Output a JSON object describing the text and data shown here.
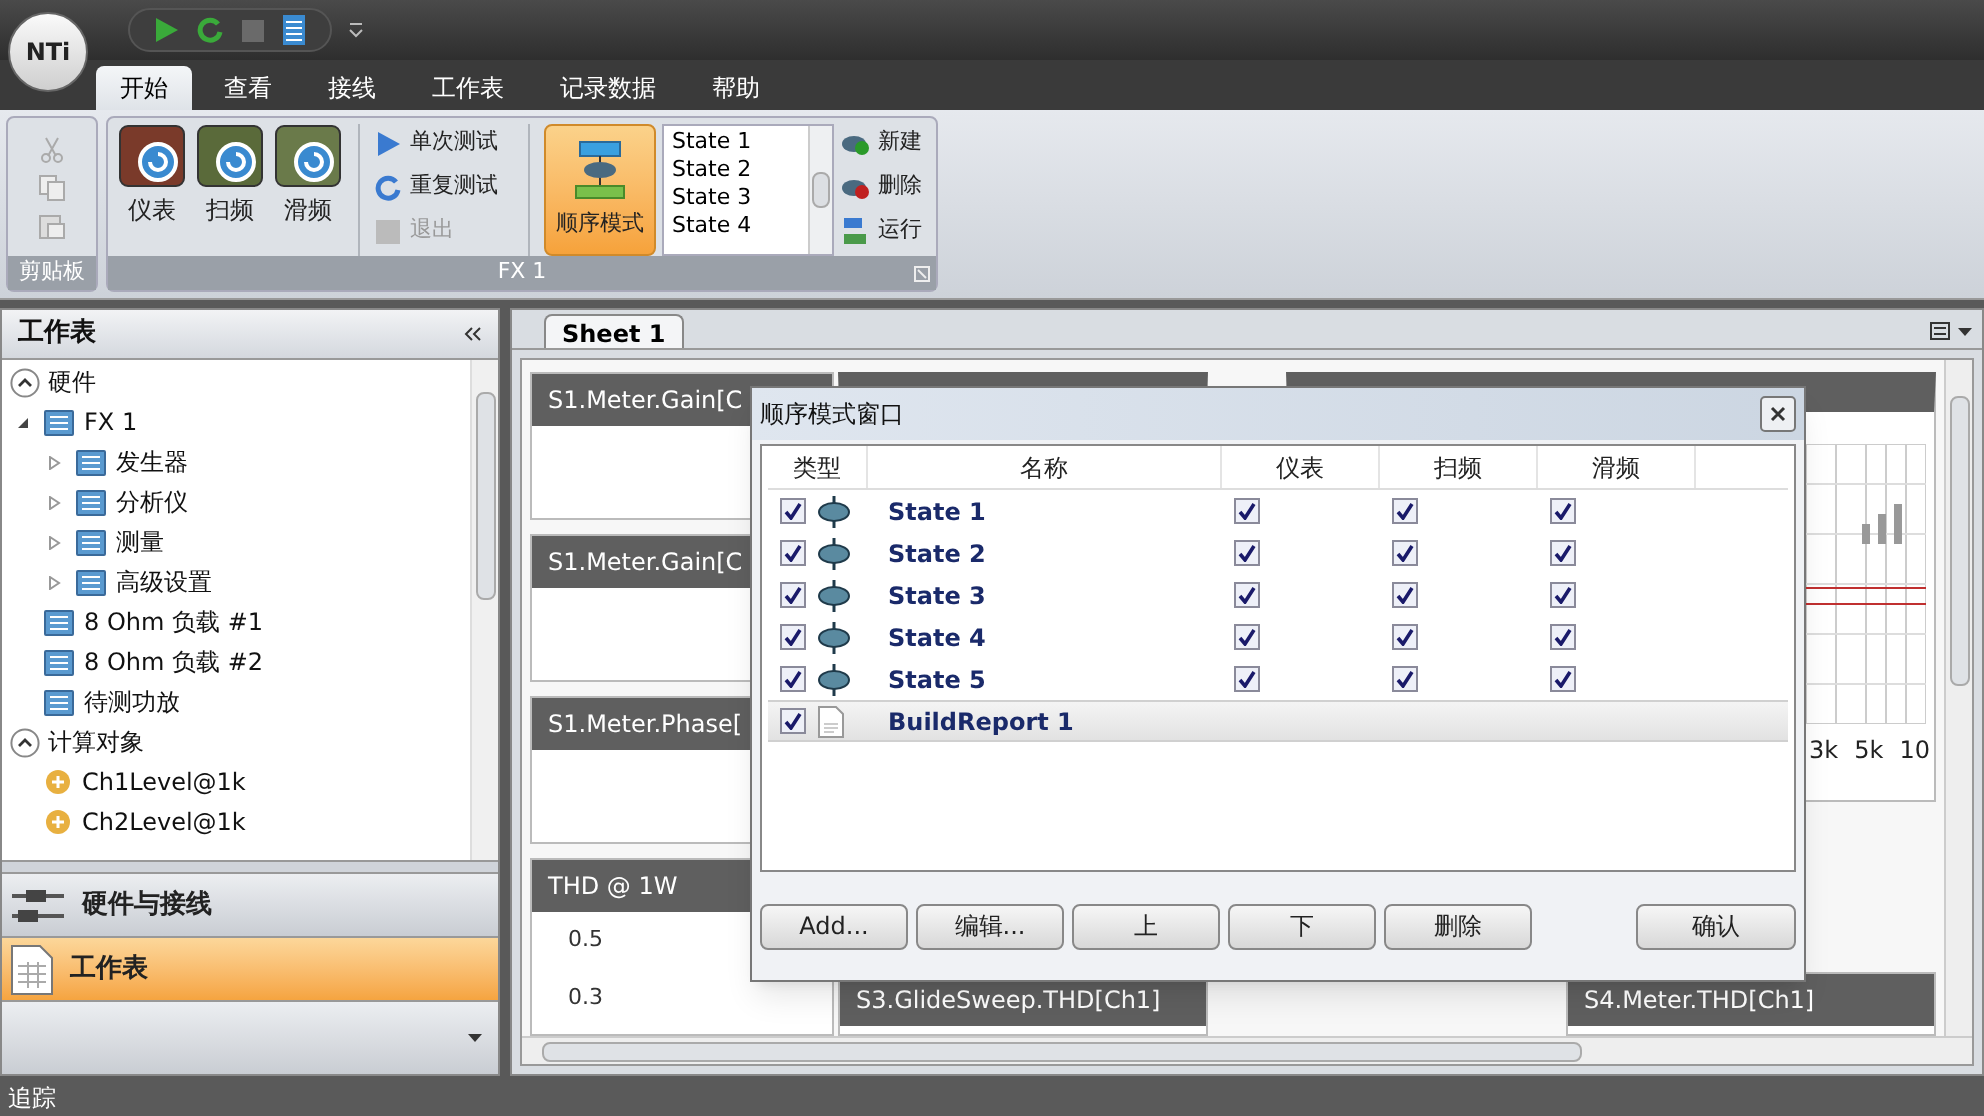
{
  "logo": "NTi",
  "menu_tabs": [
    {
      "label": "开始",
      "selected": true
    },
    {
      "label": "查看",
      "selected": false
    },
    {
      "label": "接线",
      "selected": false
    },
    {
      "label": "工作表",
      "selected": false
    },
    {
      "label": "记录数据",
      "selected": false
    },
    {
      "label": "帮助",
      "selected": false
    }
  ],
  "ribbon": {
    "clipboard": {
      "label": "剪贴板"
    },
    "fx": {
      "label": "FX 1",
      "big_buttons": [
        {
          "label": "仪表",
          "kind": "meter"
        },
        {
          "label": "扫频",
          "kind": "sweep"
        },
        {
          "label": "滑频",
          "kind": "glide"
        }
      ],
      "small_buttons": [
        {
          "label": "单次测试",
          "kind": "play",
          "disabled": false
        },
        {
          "label": "重复测试",
          "kind": "repeat",
          "disabled": false
        },
        {
          "label": "退出",
          "kind": "stop",
          "disabled": true
        }
      ],
      "sequence_button": {
        "label": "顺序模式",
        "selected": true
      },
      "state_list": [
        "State 1",
        "State 2",
        "State 3",
        "State 4"
      ],
      "actions": [
        {
          "label": "新建",
          "kind": "new"
        },
        {
          "label": "删除",
          "kind": "delete"
        },
        {
          "label": "运行",
          "kind": "run"
        }
      ]
    }
  },
  "sidebar": {
    "title": "工作表",
    "sections": [
      {
        "label": "硬件",
        "expanded": true,
        "items": [
          {
            "label": "FX 1",
            "kind": "device",
            "expanded": true,
            "children": [
              {
                "label": "发生器",
                "kind": "device",
                "expanded": false
              },
              {
                "label": "分析仪",
                "kind": "device",
                "expanded": false
              },
              {
                "label": "测量",
                "kind": "device",
                "expanded": false
              },
              {
                "label": "高级设置",
                "kind": "device",
                "expanded": false
              }
            ]
          },
          {
            "label": "8 Ohm 负载 #1",
            "kind": "device"
          },
          {
            "label": "8 Ohm 负载 #2",
            "kind": "device"
          },
          {
            "label": "待测功放",
            "kind": "device"
          }
        ]
      },
      {
        "label": "计算对象",
        "expanded": true,
        "items": [
          {
            "label": "Ch1Level@1k",
            "kind": "calc"
          },
          {
            "label": "Ch2Level@1k",
            "kind": "calc"
          }
        ]
      }
    ],
    "nav": [
      {
        "label": "硬件与接线",
        "kind": "wiring",
        "selected": false
      },
      {
        "label": "工作表",
        "kind": "sheet",
        "selected": true
      }
    ]
  },
  "sheet_tabs": [
    {
      "label": "Sheet 1",
      "selected": true
    }
  ],
  "worksheet": {
    "left_cards": [
      {
        "title": "S1.Meter.Gain[C"
      },
      {
        "title": "S1.Meter.Gain[C"
      },
      {
        "title": "S1.Meter.Phase["
      },
      {
        "title": "THD @ 1W",
        "y_labels": [
          "0.5",
          "0.3"
        ]
      }
    ],
    "right_chart": {
      "x_labels": [
        "3k",
        "5k",
        "10"
      ]
    },
    "bottom_cards": [
      {
        "title": "S3.GlideSweep.THD[Ch1]"
      },
      {
        "title": "S4.Meter.THD[Ch1]"
      }
    ]
  },
  "dialog": {
    "title": "顺序模式窗口",
    "columns": [
      "类型",
      "名称",
      "仪表",
      "扫频",
      "滑频"
    ],
    "rows": [
      {
        "kind": "state",
        "enabled": true,
        "name": "State 1",
        "meter": true,
        "sweep": true,
        "glide": true,
        "selected": false
      },
      {
        "kind": "state",
        "enabled": true,
        "name": "State 2",
        "meter": true,
        "sweep": true,
        "glide": true,
        "selected": false
      },
      {
        "kind": "state",
        "enabled": true,
        "name": "State 3",
        "meter": true,
        "sweep": true,
        "glide": true,
        "selected": false
      },
      {
        "kind": "state",
        "enabled": true,
        "name": "State 4",
        "meter": true,
        "sweep": true,
        "glide": true,
        "selected": false
      },
      {
        "kind": "state",
        "enabled": true,
        "name": "State 5",
        "meter": true,
        "sweep": true,
        "glide": true,
        "selected": false
      },
      {
        "kind": "report",
        "enabled": true,
        "name": "BuildReport 1",
        "selected": true
      }
    ],
    "buttons": [
      "Add...",
      "编辑...",
      "上",
      "下",
      "删除"
    ],
    "confirm": "确认"
  },
  "status_bar": "追踪"
}
